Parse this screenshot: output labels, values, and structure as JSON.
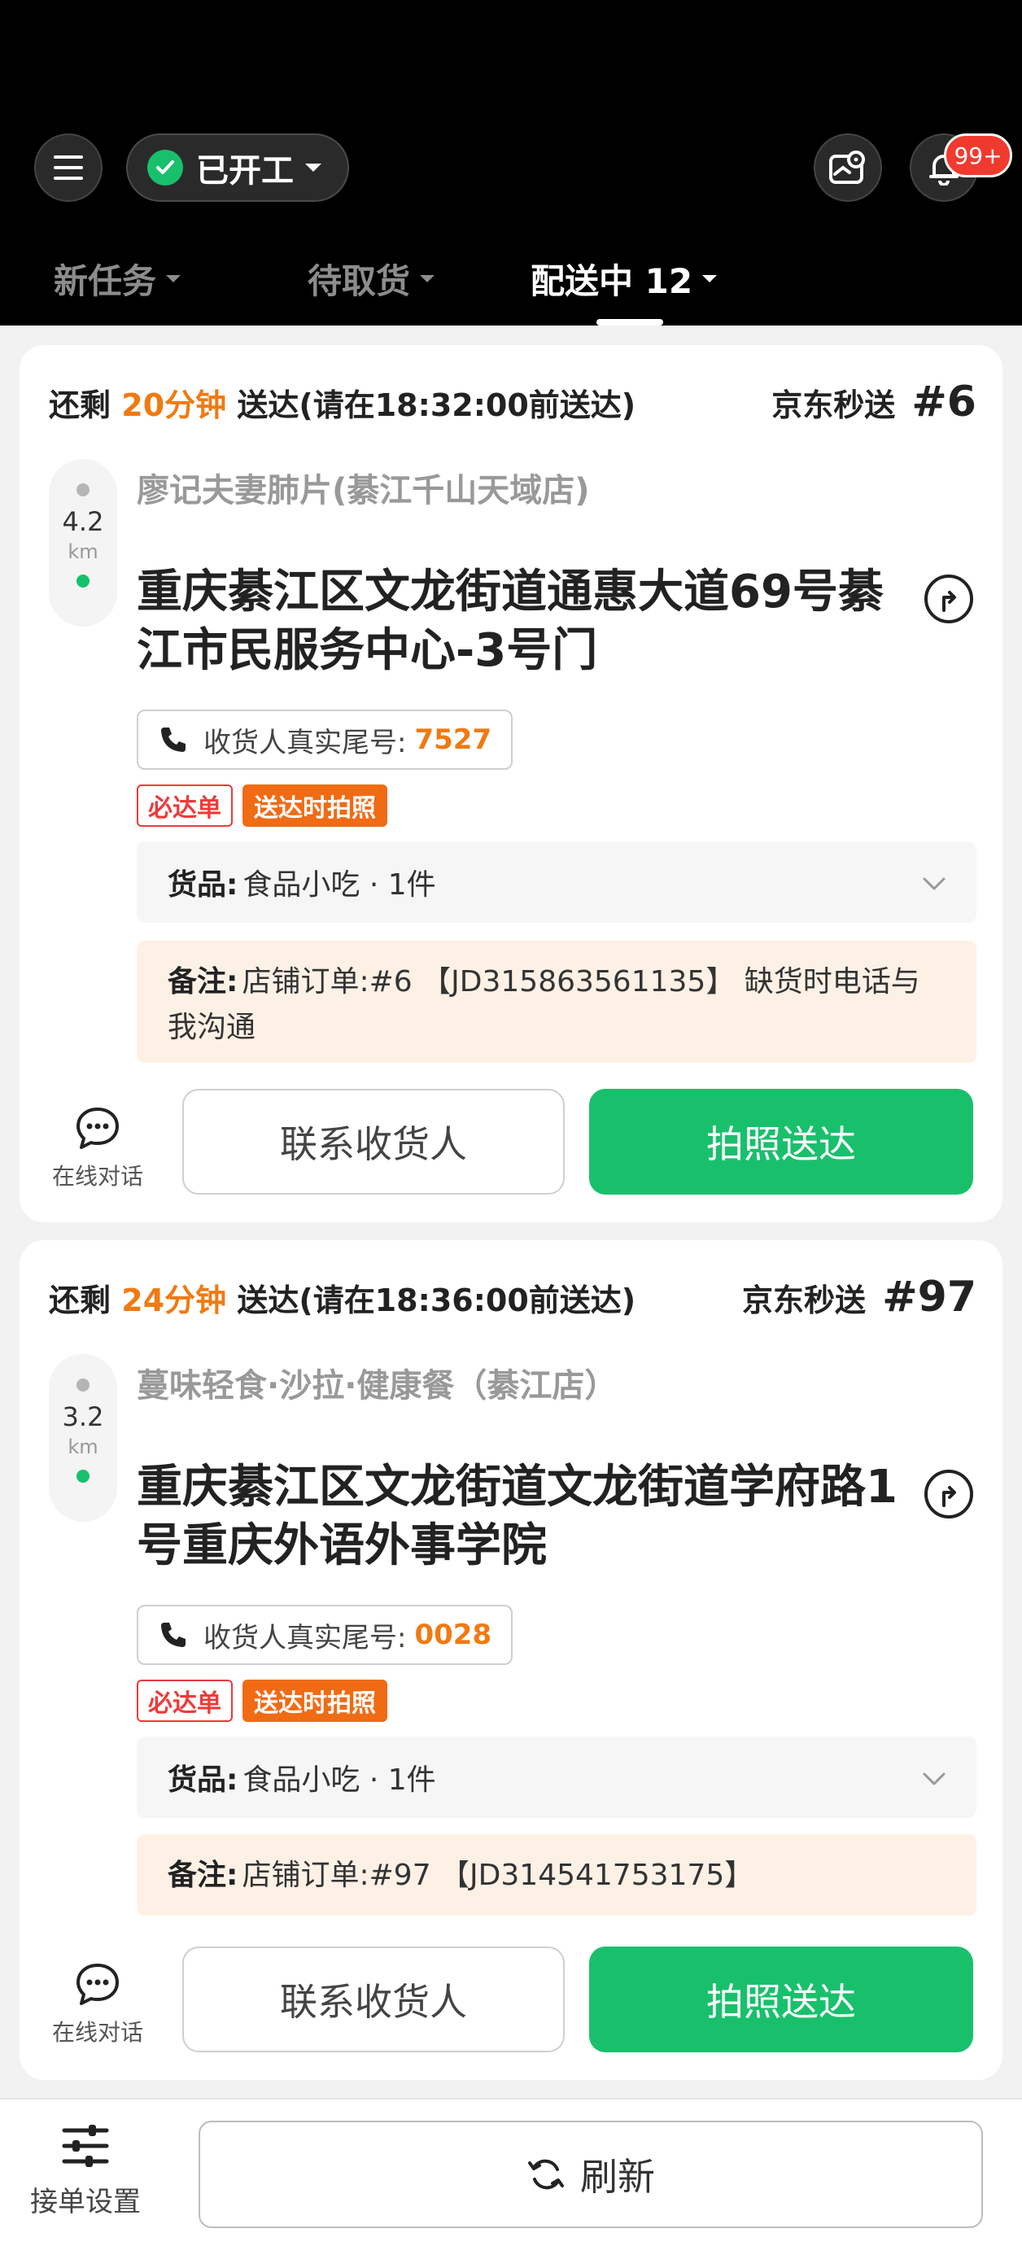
{
  "header": {
    "status_label": "已开工",
    "notification_badge": "99+",
    "tabs": [
      {
        "label": "新任务"
      },
      {
        "label": "待取货"
      },
      {
        "label": "配送中 12"
      }
    ]
  },
  "orders": [
    {
      "remain_prefix": "还剩",
      "remain_minutes": "20分钟",
      "remain_suffix": "送达(请在18:32:00前送达)",
      "service_name": "京东秒送",
      "order_no": "#6",
      "distance_value": "4.2",
      "distance_unit": "km",
      "shop_name": "廖记夫妻肺片(綦江千山天域店)",
      "address": "重庆綦江区文龙街道通惠大道69号綦江市民服务中心-3号门",
      "phone_label": "收货人真实尾号:",
      "phone_tail": "7527",
      "tag_must": "必达单",
      "tag_photo": "送达时拍照",
      "goods_key": "货品:",
      "goods_value": "食品小吃 · 1件",
      "note_key": "备注:",
      "note_value": "店铺订单:#6 【JD315863561135】 缺货时电话与我沟通",
      "chat_label": "在线对话",
      "contact_button": "联系收货人",
      "deliver_button": "拍照送达"
    },
    {
      "remain_prefix": "还剩",
      "remain_minutes": "24分钟",
      "remain_suffix": "送达(请在18:36:00前送达)",
      "service_name": "京东秒送",
      "order_no": "#97",
      "distance_value": "3.2",
      "distance_unit": "km",
      "shop_name": "蔓味轻食·沙拉·健康餐（綦江店）",
      "address": "重庆綦江区文龙街道文龙街道学府路1号重庆外语外事学院",
      "phone_label": "收货人真实尾号:",
      "phone_tail": "0028",
      "tag_must": "必达单",
      "tag_photo": "送达时拍照",
      "goods_key": "货品:",
      "goods_value": "食品小吃 · 1件",
      "note_key": "备注:",
      "note_value": "店铺订单:#97 【JD314541753175】",
      "chat_label": "在线对话",
      "contact_button": "联系收货人",
      "deliver_button": "拍照送达"
    }
  ],
  "bottom_bar": {
    "settings_label": "接单设置",
    "refresh_label": "刷新"
  },
  "colors": {
    "accent_green": "#19c06c",
    "accent_orange": "#f07a12",
    "tag_red": "#ec3b3b",
    "badge_red": "#f03a2e"
  },
  "icons": [
    "menu-icon",
    "check-circle-icon",
    "map-pin-icon",
    "bell-icon",
    "navigation-icon",
    "phone-icon",
    "chevron-down-icon",
    "chat-bubble-icon",
    "sliders-icon",
    "refresh-icon"
  ]
}
